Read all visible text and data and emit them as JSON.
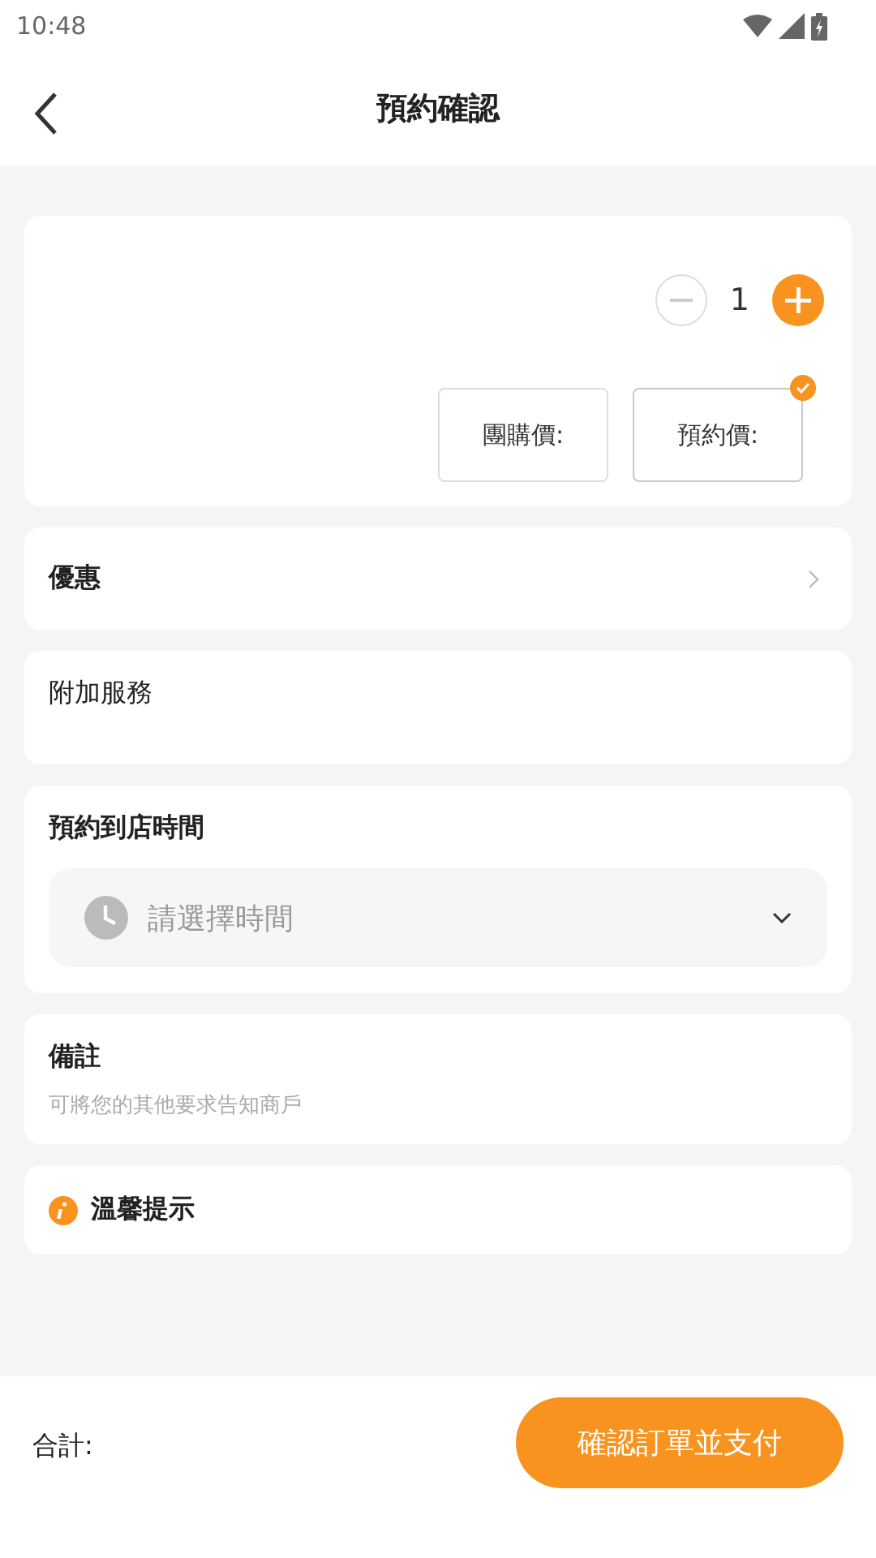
{
  "status_bar": {
    "time": "10:48"
  },
  "header": {
    "title": "預約確認"
  },
  "product": {
    "quantity": "1",
    "price_options": [
      {
        "label": "團購價:",
        "selected": false
      },
      {
        "label": "預約價:",
        "selected": true
      }
    ]
  },
  "discount": {
    "label": "優惠"
  },
  "extra_services": {
    "label": "附加服務"
  },
  "arrival_time": {
    "label": "預約到店時間",
    "placeholder": "請選擇時間"
  },
  "remarks": {
    "label": "備註",
    "placeholder": "可將您的其他要求告知商戶"
  },
  "tips": {
    "label": "溫馨提示"
  },
  "footer": {
    "total_label": "合計:",
    "submit": "確認訂單並支付"
  }
}
